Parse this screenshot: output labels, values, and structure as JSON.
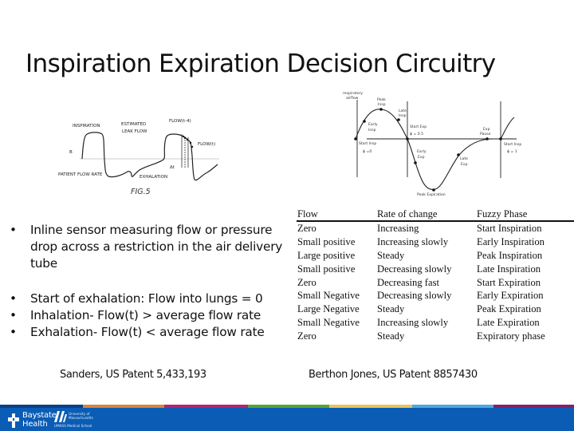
{
  "title": "Inspiration Expiration Decision Circuitry",
  "left_figure": {
    "caption": "FIG.5",
    "labels": {
      "inspiration": "INSPIRATION",
      "estimated_1": "ESTIMATED",
      "estimated_2": "LEAK FLOW",
      "flow_t4": "FLOW(t-4)",
      "flow_t": "FLOW(t)",
      "b": "B",
      "delta_t": "Δt",
      "exhalation": "EXHALATION",
      "patient_flow": "PATIENT FLOW RATE"
    }
  },
  "right_figure": {
    "labels": {
      "airflow_1": "respiratory",
      "airflow_2": "airflow",
      "peak_insp_1": "Peak",
      "peak_insp_2": "Insp",
      "late_insp_1": "Late",
      "late_insp_2": "Insp",
      "early_insp_1": "Early",
      "early_insp_2": "Insp",
      "start_insp": "Start Insp",
      "phi0": "ϕ =0",
      "start_exp": "Start Exp",
      "phi05": "ϕ = 0.5",
      "early_exp_1": "Early",
      "early_exp_2": "Exp",
      "late_exp_1": "Late",
      "late_exp_2": "Exp",
      "exp_pause_1": "Exp",
      "exp_pause_2": "Pause",
      "start_insp2": "Start Insp",
      "phi1": "ϕ = 1",
      "peak_exp": "Peak Expiration"
    }
  },
  "bullets": [
    {
      "symbol": "•",
      "text": "Inline sensor measuring flow or pressure drop across a restriction in the air delivery tube"
    },
    {
      "symbol": "•",
      "text": "Start of exhalation: Flow into lungs = 0"
    },
    {
      "symbol": "•",
      "text": "Inhalation- Flow(t) > average flow rate"
    },
    {
      "symbol": "•",
      "text": "Exhalation- Flow(t) < average flow rate"
    }
  ],
  "table": {
    "headers": [
      "Flow",
      "Rate of change",
      "Fuzzy Phase"
    ],
    "rows": [
      [
        "Zero",
        "Increasing",
        "Start Inspiration"
      ],
      [
        "Small positive",
        "Increasing slowly",
        "Early Inspiration"
      ],
      [
        "Large positive",
        "Steady",
        "Peak Inspiration"
      ],
      [
        "Small positive",
        "Decreasing slowly",
        "Late Inspiration"
      ],
      [
        "Zero",
        "Decreasing fast",
        "Start Expiration"
      ],
      [
        "Small Negative",
        "Decreasing slowly",
        "Early Expiration"
      ],
      [
        "Large Negative",
        "Steady",
        "Peak Expiration"
      ],
      [
        "Small Negative",
        "Increasing slowly",
        "Late Expiration"
      ],
      [
        "Zero",
        "Steady",
        "Expiratory phase"
      ]
    ]
  },
  "citations": {
    "left": "Sanders, US Patent 5,433,193",
    "right": "Berthon Jones, US Patent 8857430"
  },
  "footer": {
    "bh_line1": "Baystate",
    "bh_line2": "Health",
    "umass_line1": "University of",
    "umass_line2": "Massachusetts",
    "umass_line3": "UMASS Medical School",
    "background": "#0a5cb5",
    "stripe_colors": [
      "#0b3f86",
      "#d8843f",
      "#b4256e",
      "#5aa232",
      "#e6c45a",
      "#4fa9dc",
      "#8a1f6a"
    ]
  }
}
